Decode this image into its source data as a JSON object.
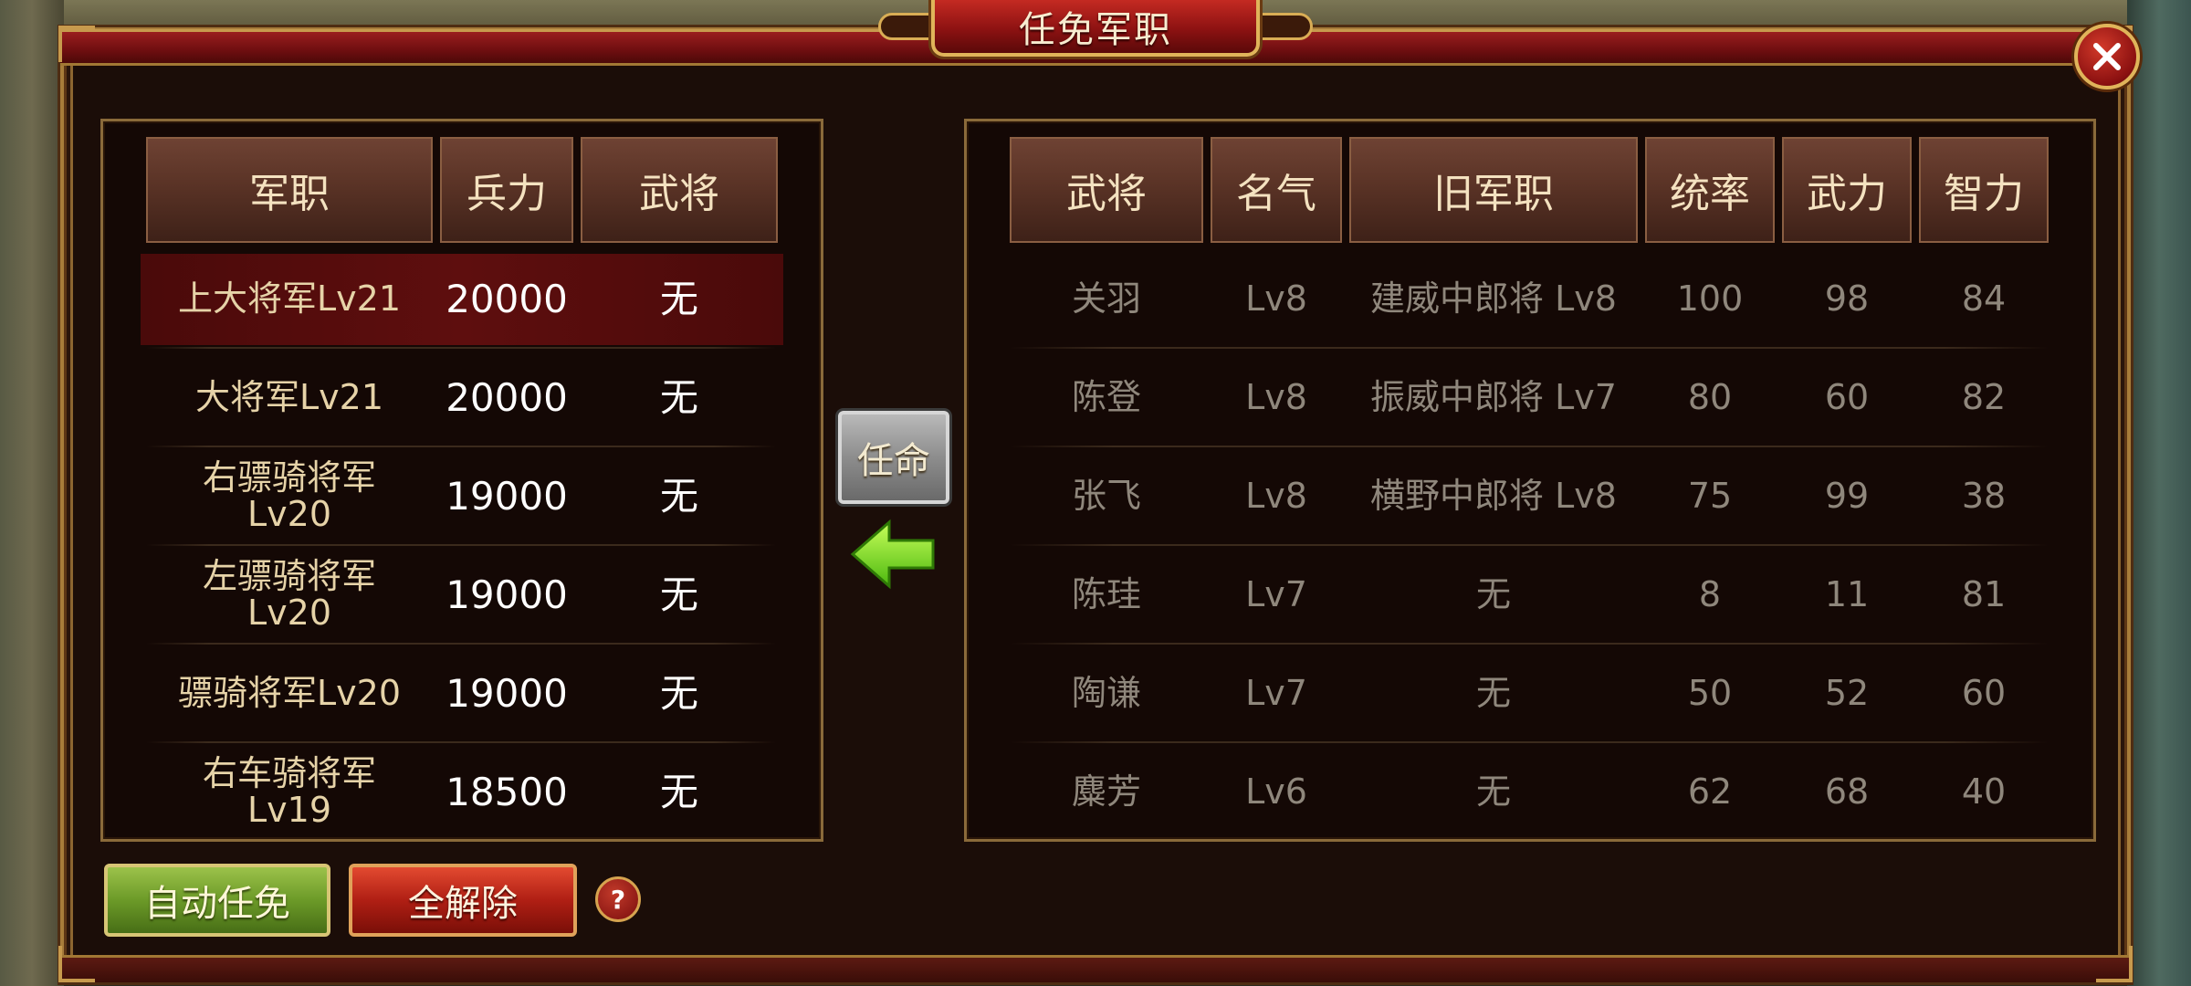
{
  "title": "任免军职",
  "close_icon": "close-icon",
  "left_table": {
    "headers": [
      "军职",
      "兵力",
      "武将"
    ],
    "rows": [
      {
        "position": "上大将军Lv21",
        "troops": "20000",
        "general": "无",
        "selected": true
      },
      {
        "position": "大将军Lv21",
        "troops": "20000",
        "general": "无"
      },
      {
        "position": "右骠骑将军\nLv20",
        "troops": "19000",
        "general": "无"
      },
      {
        "position": "左骠骑将军\nLv20",
        "troops": "19000",
        "general": "无"
      },
      {
        "position": "骠骑将军Lv20",
        "troops": "19000",
        "general": "无"
      },
      {
        "position": "右车骑将军\nLv19",
        "troops": "18500",
        "general": "无"
      }
    ]
  },
  "right_table": {
    "headers": [
      "武将",
      "名气",
      "旧军职",
      "统率",
      "武力",
      "智力"
    ],
    "rows": [
      {
        "general": "关羽",
        "fame": "Lv8",
        "old_position": "建威中郎将 Lv8",
        "command": "100",
        "force": "98",
        "intellect": "84"
      },
      {
        "general": "陈登",
        "fame": "Lv8",
        "old_position": "振威中郎将 Lv7",
        "command": "80",
        "force": "60",
        "intellect": "82"
      },
      {
        "general": "张飞",
        "fame": "Lv8",
        "old_position": "横野中郎将 Lv8",
        "command": "75",
        "force": "99",
        "intellect": "38"
      },
      {
        "general": "陈珪",
        "fame": "Lv7",
        "old_position": "无",
        "command": "8",
        "force": "11",
        "intellect": "81"
      },
      {
        "general": "陶谦",
        "fame": "Lv7",
        "old_position": "无",
        "command": "50",
        "force": "52",
        "intellect": "60"
      },
      {
        "general": "麋芳",
        "fame": "Lv6",
        "old_position": "无",
        "command": "62",
        "force": "68",
        "intellect": "40"
      }
    ]
  },
  "appoint_button": "任命",
  "arrow_icon": "arrow-left-icon",
  "auto_appoint_button": "自动任免",
  "clear_all_button": "全解除",
  "help_button": "?",
  "colors": {
    "selected_row": "#5e0e0e",
    "auto_button": "#6c9a28",
    "clear_button": "#b01f14",
    "arrow": "#7ee02a"
  }
}
